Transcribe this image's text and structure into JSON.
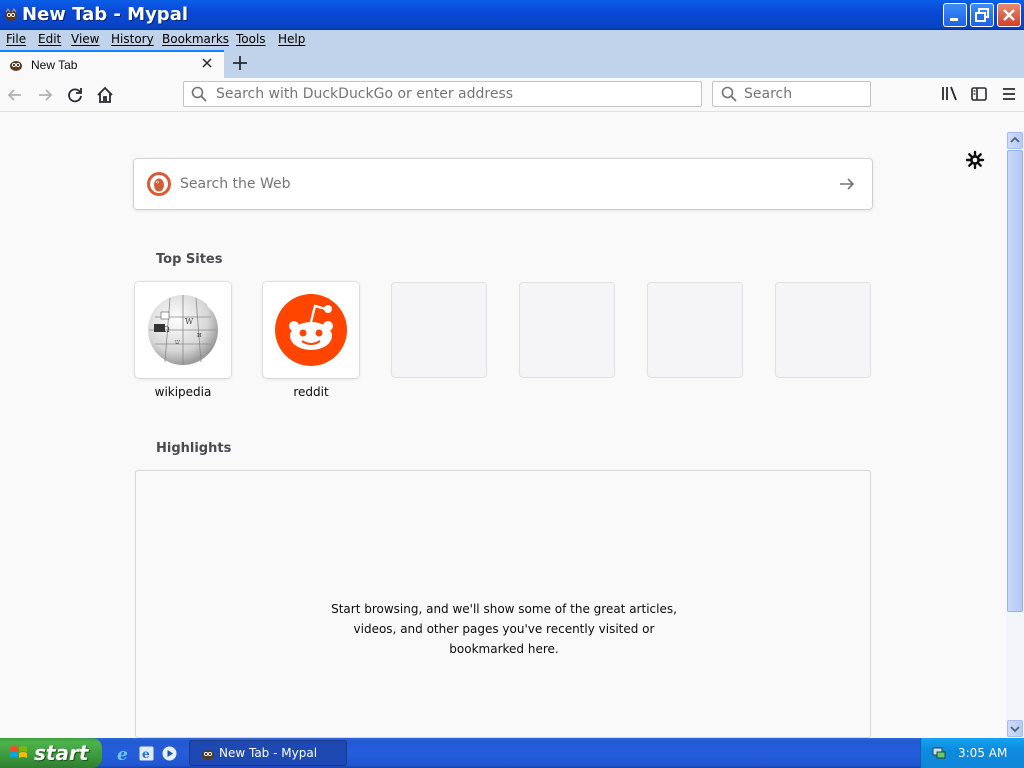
{
  "window": {
    "title": "New Tab - Mypal"
  },
  "menubar": {
    "items": [
      "File",
      "Edit",
      "View",
      "History",
      "Bookmarks",
      "Tools",
      "Help"
    ]
  },
  "tabs": [
    {
      "label": "New Tab",
      "active": true
    }
  ],
  "navbar": {
    "url_placeholder": "Search with DuckDuckGo or enter address",
    "search_placeholder": "Search"
  },
  "newtab": {
    "websearch_placeholder": "Search the Web",
    "top_sites_title": "Top Sites",
    "top_sites": [
      {
        "label": "wikipedia",
        "icon": "wikipedia-globe-icon"
      },
      {
        "label": "reddit",
        "icon": "reddit-alien-icon"
      },
      {
        "label": "",
        "icon": ""
      },
      {
        "label": "",
        "icon": ""
      },
      {
        "label": "",
        "icon": ""
      },
      {
        "label": "",
        "icon": ""
      }
    ],
    "highlights_title": "Highlights",
    "highlights_empty_lines": [
      "Start browsing, and we'll show some of the great articles,",
      "videos, and other pages you've recently visited or",
      "bookmarked here."
    ]
  },
  "taskbar": {
    "start_label": "start",
    "task_label": "New Tab - Mypal",
    "clock": "3:05 AM"
  },
  "colors": {
    "titlebar": "#0a4fdc",
    "menubar": "#c1d3ea",
    "accent_tab": "#0a84ff",
    "reddit": "#ff4500",
    "taskbar": "#245ddb",
    "start": "#3c9a3c",
    "tray": "#0f86d8"
  }
}
